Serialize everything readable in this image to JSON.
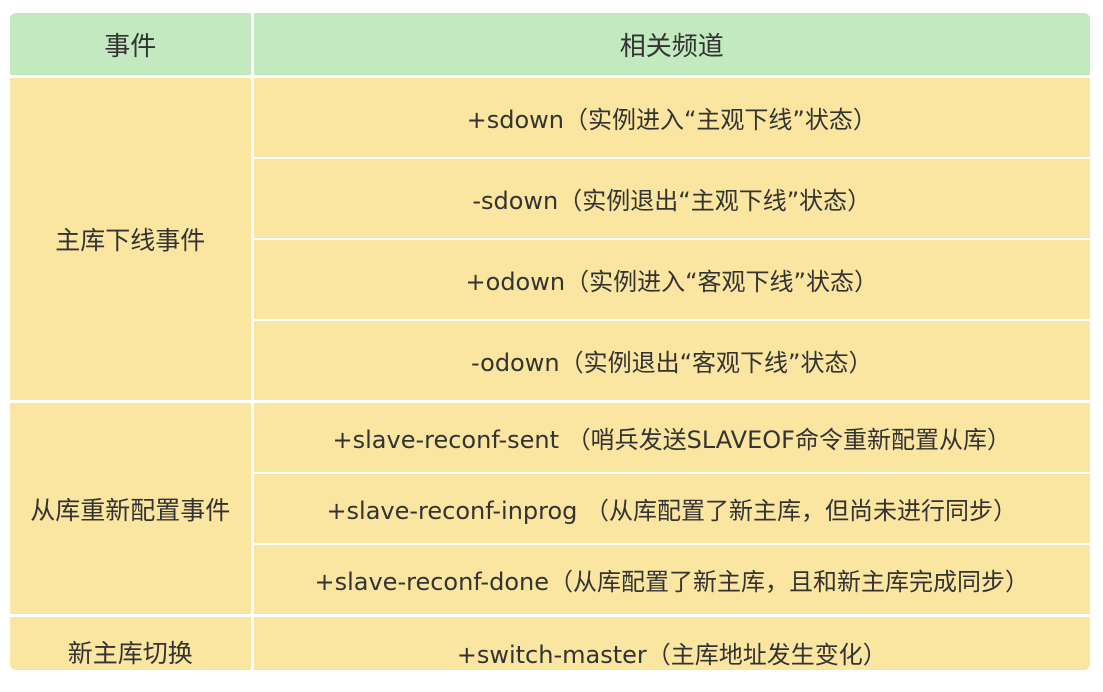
{
  "table": {
    "headers": [
      "事件",
      "相关频道"
    ],
    "groups": [
      {
        "event": "主库下线事件",
        "channels": [
          "+sdown（实例进入“主观下线”状态）",
          "-sdown（实例退出“主观下线”状态）",
          "+odown（实例进入“客观下线”状态）",
          "-odown（实例退出“客观下线”状态）"
        ]
      },
      {
        "event": "从库重新配置事件",
        "channels": [
          "+slave-reconf-sent （哨兵发送SLAVEOF命令重新配置从库）",
          "+slave-reconf-inprog （从库配置了新主库，但尚未进行同步）",
          "+slave-reconf-done（从库配置了新主库，且和新主库完成同步）"
        ]
      },
      {
        "event": "新主库切换",
        "channels": [
          "+switch-master（主库地址发生变化）"
        ]
      }
    ]
  },
  "colors": {
    "header_bg": "#c3e9c0",
    "cell_bg": "#fbe6a1",
    "text": "#333333",
    "divider": "#ffffff"
  }
}
